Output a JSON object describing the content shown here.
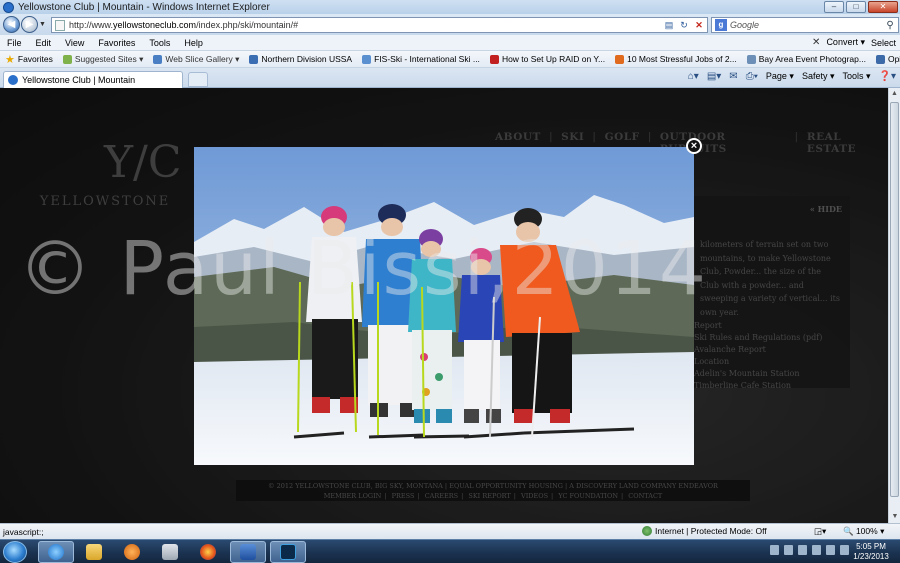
{
  "window": {
    "title": "Yellowstone Club | Mountain - Windows Internet Explorer"
  },
  "address": {
    "url_prefix": "http://www.",
    "url_domain": "yellowstoneclub.com",
    "url_path": "/index.php/ski/mountain/#",
    "search_placeholder": "Google"
  },
  "menu": {
    "items": [
      "File",
      "Edit",
      "View",
      "Favorites",
      "Tools",
      "Help"
    ],
    "convert": "Convert",
    "select": "Select"
  },
  "favorites": {
    "label": "Favorites",
    "items": [
      "Suggested Sites ▾",
      "Web Slice Gallery ▾",
      "Northern Division USSA",
      "FIS-Ski - International Ski ...",
      "How to Set Up RAID on Y...",
      "10 Most Stressful Jobs of 2...",
      "Bay Area Event Photograp...",
      "Opinion Forum » Ski Raci..."
    ]
  },
  "tab": {
    "title": "Yellowstone Club | Mountain"
  },
  "commandbar": {
    "page": "Page ▾",
    "safety": "Safety ▾",
    "tools": "Tools ▾"
  },
  "site": {
    "logo_mark": "Y/C",
    "logo_text": "YELLOWSTONE",
    "nav": [
      "ABOUT",
      "SKI",
      "GOLF",
      "OUTDOOR PURSUITS",
      "REAL ESTATE"
    ],
    "panel_hide": "« HIDE",
    "panel_text": "kilometers of terrain set on two mountains, to make Yellowstone Club, Powder... the size of the Club with a powder... and sweeping a variety of vertical... its own year.",
    "panel_links": [
      "Report",
      "Ski Rules and Regulations (pdf)",
      "Avalanche Report",
      "Location",
      "Adelin's Mountain Station",
      "Timberline Cafe Station"
    ],
    "footer_line1": "© 2012 YELLOWSTONE CLUB, BIG SKY, MONTANA | EQUAL OPPORTUNITY HOUSING | A DISCOVERY LAND COMPANY ENDEAVOR",
    "footer_links": [
      "MEMBER LOGIN",
      "PRESS",
      "CAREERS",
      "SKI REPORT",
      "VIDEOS",
      "YC FOUNDATION",
      "CONTACT"
    ]
  },
  "lightbox": {
    "close": "×"
  },
  "watermark": "© Paul Bissi,2014",
  "status": {
    "left": "javascript:;",
    "zone": "Internet | Protected Mode: Off",
    "zoom": "100%"
  },
  "taskbar": {
    "time": "5:05 PM",
    "date": "1/23/2013"
  },
  "colors": {
    "ie_blue": "#2a6fc9",
    "jacket_orange": "#f05a1e",
    "jacket_blue": "#2f7fd0"
  }
}
